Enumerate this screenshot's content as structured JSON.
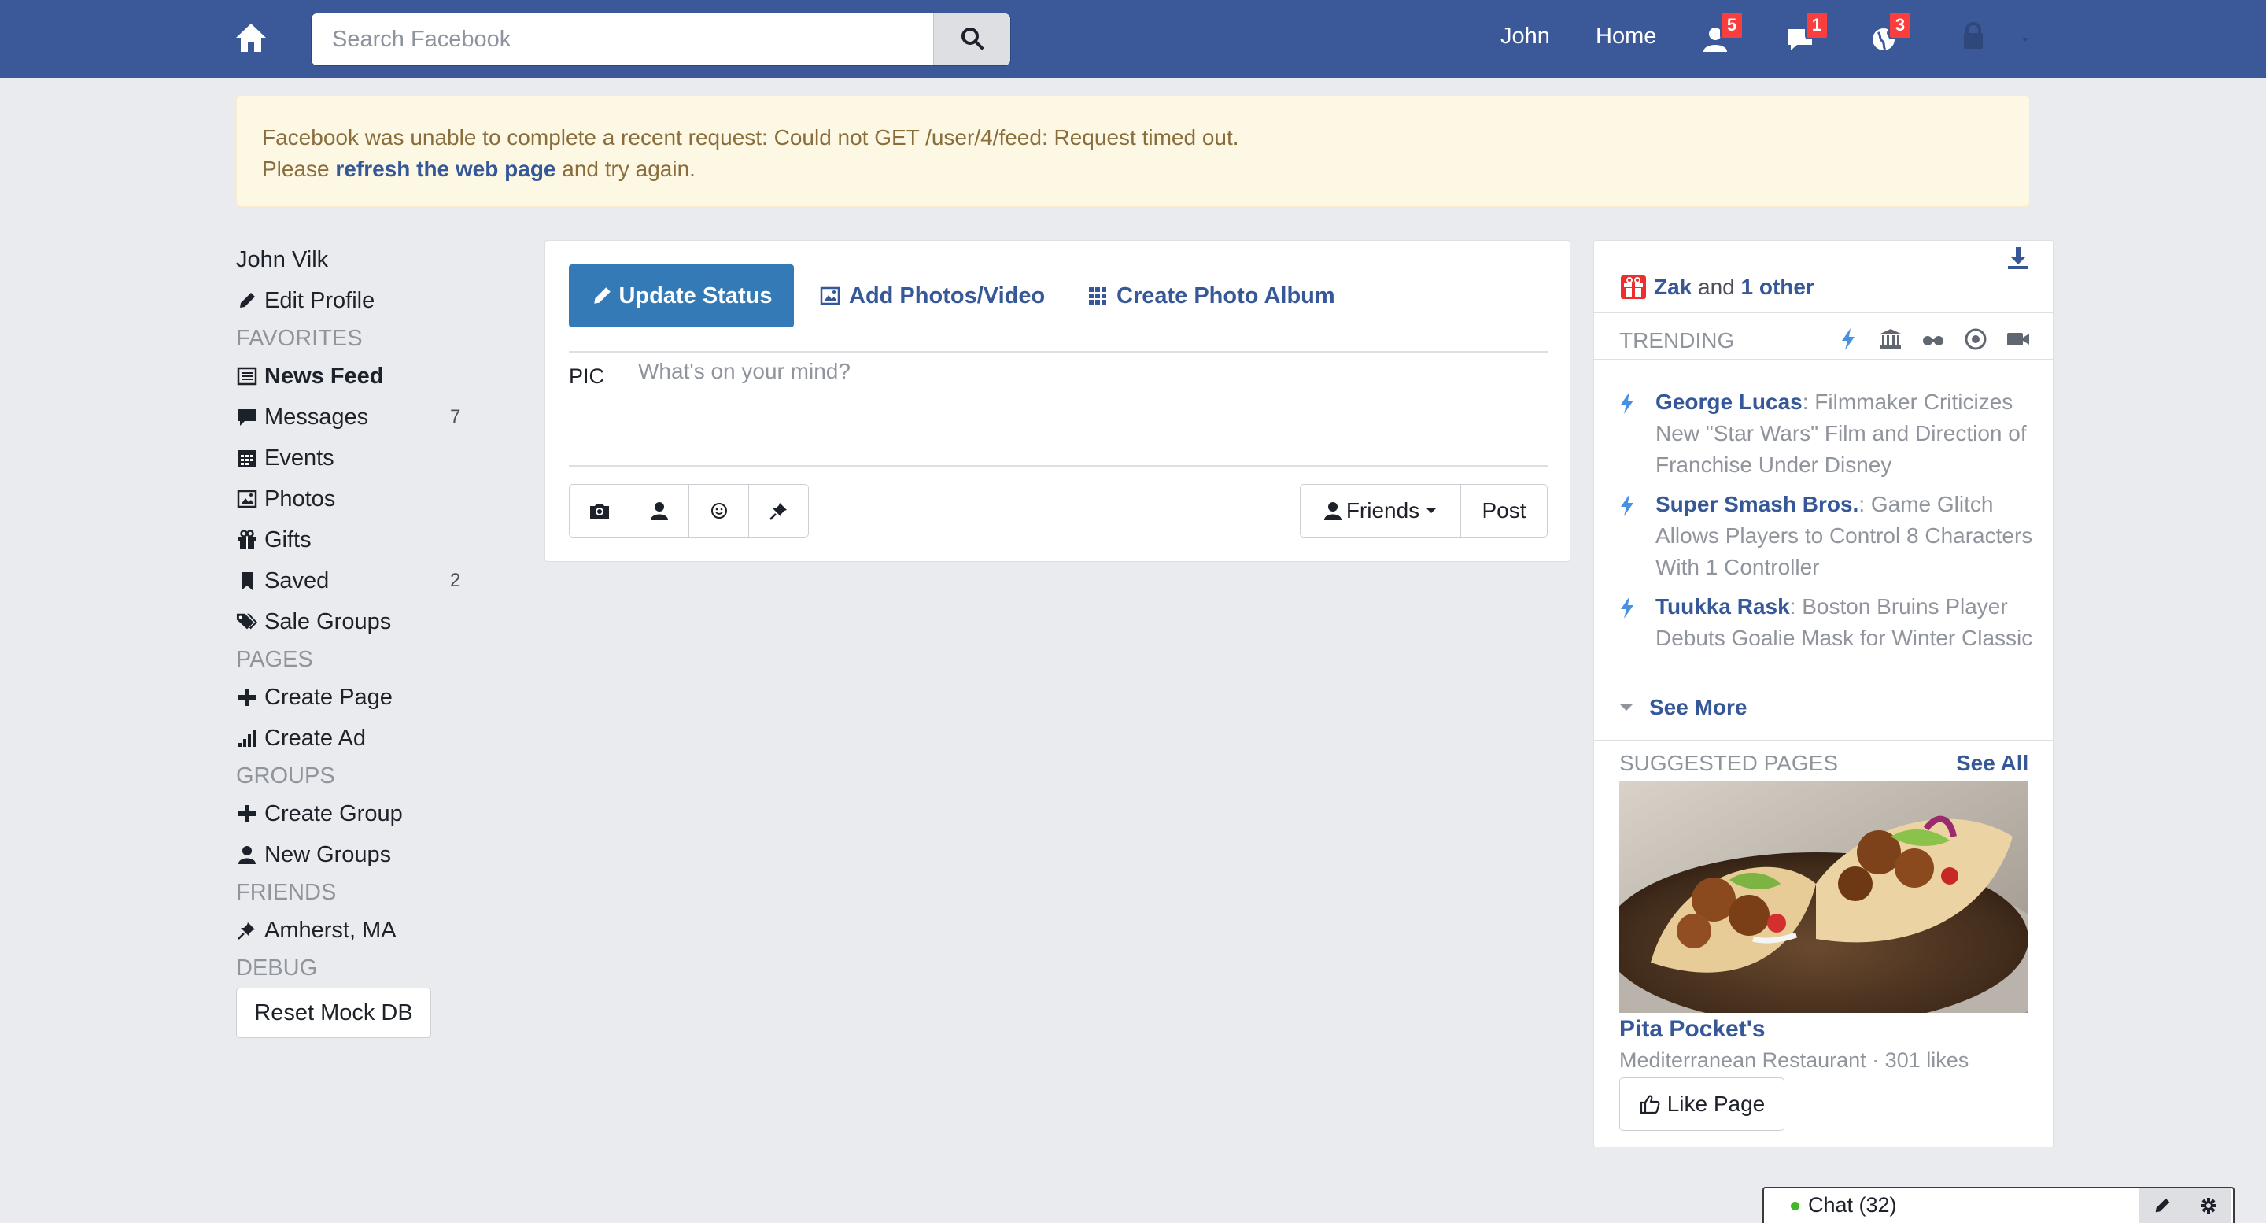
{
  "topbar": {
    "search_placeholder": "Search Facebook",
    "user_link": "John",
    "home_link": "Home",
    "friend_requests_count": "5",
    "messages_count": "1",
    "notifications_count": "3"
  },
  "alert": {
    "line1": "Facebook was unable to complete a recent request: Could not GET /user/4/feed: Request timed out.",
    "line2_prefix": "Please ",
    "line2_link": "refresh the web page",
    "line2_suffix": " and try again."
  },
  "leftnav": {
    "user_name": "John Vilk",
    "edit_profile": "Edit Profile",
    "favorites_header": "FAVORITES",
    "news_feed": "News Feed",
    "messages": "Messages",
    "messages_count": "7",
    "events": "Events",
    "photos": "Photos",
    "gifts": "Gifts",
    "saved": "Saved",
    "saved_count": "2",
    "sale_groups": "Sale Groups",
    "pages_header": "PAGES",
    "create_page": "Create Page",
    "create_ad": "Create Ad",
    "groups_header": "GROUPS",
    "create_group": "Create Group",
    "new_groups": "New Groups",
    "friends_header": "FRIENDS",
    "location": "Amherst, MA",
    "debug_header": "DEBUG",
    "reset_button": "Reset Mock DB"
  },
  "composer": {
    "tab_update_status": "Update Status",
    "tab_add_photos": "Add Photos/Video",
    "tab_create_album": "Create Photo Album",
    "pic_label": "PIC",
    "status_placeholder": "What's on your mind?",
    "audience": "Friends",
    "post_button": "Post"
  },
  "rightcol": {
    "birthday_name": "Zak",
    "birthday_and": " and ",
    "birthday_other": "1 other",
    "trending_header": "TRENDING",
    "trends": [
      {
        "topic": "George Lucas",
        "desc": ": Filmmaker Criticizes New \"Star Wars\" Film and Direction of Franchise Under Disney"
      },
      {
        "topic": "Super Smash Bros.",
        "desc": ": Game Glitch Allows Players to Control 8 Characters With 1 Controller"
      },
      {
        "topic": "Tuukka Rask",
        "desc": ": Boston Bruins Player Debuts Goalie Mask for Winter Classic"
      }
    ],
    "see_more": "See More",
    "suggested_header": "SUGGESTED PAGES",
    "see_all": "See All",
    "page_name": "Pita Pocket's",
    "page_meta": "Mediterranean Restaurant · 301 likes",
    "like_button": "Like Page"
  },
  "chat": {
    "label": "Chat (32)"
  },
  "colors": {
    "brand_blue": "#3b5998",
    "link_blue": "#365899",
    "primary_button": "#337ab7",
    "alert_bg": "#fcf8e3",
    "alert_text": "#8a6d3b",
    "badge_red": "#fa3e3e",
    "online_green": "#42b72a"
  }
}
